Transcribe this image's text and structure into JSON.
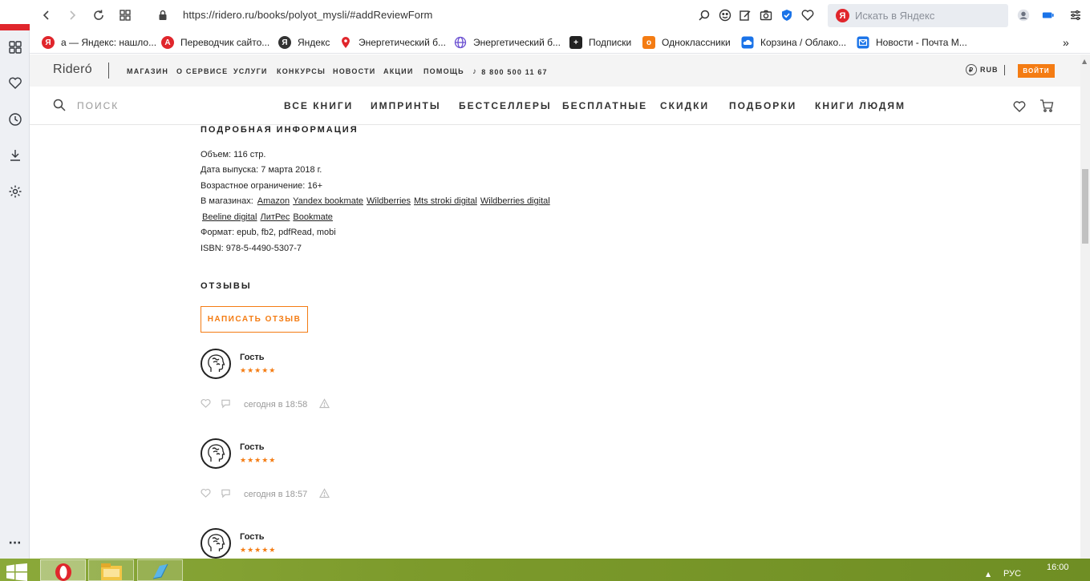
{
  "browser": {
    "url": "https://ridero.ru/books/polyot_mysli/#addReviewForm",
    "search_placeholder": "Искать в Яндекс",
    "search_logo": "Я",
    "bookmarks": [
      {
        "label": "а — Яндекс: нашло...",
        "icon": "yandex-icon",
        "color": "#e0262c",
        "glyph": "Я"
      },
      {
        "label": "Переводчик сайто...",
        "icon": "translate-icon",
        "color": "#e0262c",
        "glyph": "A"
      },
      {
        "label": "Яндекс",
        "icon": "yandex-browser-icon",
        "color": "#333333",
        "glyph": "Я"
      },
      {
        "label": "Энергетический б...",
        "icon": "location-pin-icon",
        "color": "#e0262c",
        "glyph": ""
      },
      {
        "label": "Энергетический б...",
        "icon": "globe-icon",
        "color": "#6a4fd1",
        "glyph": ""
      },
      {
        "label": "Подписки",
        "icon": "plus-icon",
        "color": "#222222",
        "glyph": "+"
      },
      {
        "label": "Одноклассники",
        "icon": "odnoklassniki-icon",
        "color": "#f47c13",
        "glyph": "o"
      },
      {
        "label": "Корзина / Облако...",
        "icon": "cloud-icon",
        "color": "#1a73e8",
        "glyph": ""
      },
      {
        "label": "Новости - Почта М...",
        "icon": "mail-icon",
        "color": "#1a73e8",
        "glyph": ""
      }
    ]
  },
  "site": {
    "logo": "Rideró",
    "top_nav": [
      "МАГАЗИН",
      "О СЕРВИСЕ",
      "УСЛУГИ",
      "КОНКУРСЫ",
      "НОВОСТИ",
      "АКЦИИ",
      "ПОМОЩЬ"
    ],
    "phone": "8 800 500 11 67",
    "currency": "RUB",
    "currency_symbol": "₽",
    "login": "ВОЙТИ",
    "search_placeholder": "ПОИСК",
    "main_nav": [
      "ВСЕ КНИГИ",
      "ИМПРИНТЫ",
      "БЕСТСЕЛЛЕРЫ",
      "БЕСПЛАТНЫЕ",
      "СКИДКИ",
      "ПОДБОРКИ",
      "КНИГИ ЛЮДЯМ"
    ],
    "accent": "#f47c13"
  },
  "details": {
    "heading": "ПОДРОБНАЯ ИНФОРМАЦИЯ",
    "volume": "Объем: 116 стр.",
    "release": "Дата выпуска: 7 марта 2018 г.",
    "age": "Возрастное ограничение: 16+",
    "stores_label": "В магазинах:",
    "stores": [
      "Amazon",
      "Yandex bookmate",
      "Wildberries",
      "Mts stroki digital",
      "Wildberries digital",
      "Beeline digital",
      "ЛитРес",
      "Bookmate"
    ],
    "format": "Формат: epub, fb2, pdfRead, mobi",
    "isbn": "ISBN: 978-5-4490-5307-7"
  },
  "reviews": {
    "heading": "ОТЗЫВЫ",
    "write_button": "НАПИСАТЬ ОТЗЫВ",
    "items": [
      {
        "name": "Гость",
        "stars": "★★★★★",
        "rating": 5,
        "time": "сегодня в 18:58"
      },
      {
        "name": "Гость",
        "stars": "★★★★★",
        "rating": 5,
        "time": "сегодня в 18:57"
      },
      {
        "name": "Гость",
        "stars": "★★★★★",
        "rating": 5,
        "time": ""
      }
    ]
  },
  "taskbar": {
    "lang": "РУС",
    "time": "16:00"
  }
}
